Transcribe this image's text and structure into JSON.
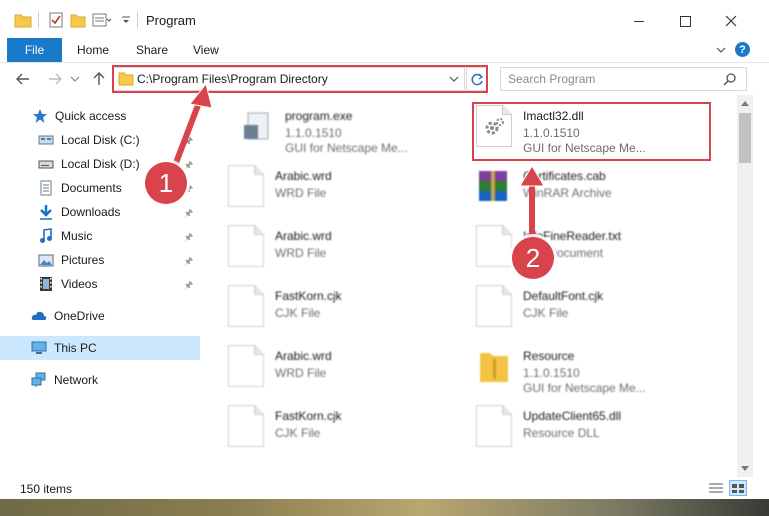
{
  "window": {
    "title": "Program",
    "controls": {
      "minimize": "—",
      "maximize": "☐",
      "close": "✕"
    }
  },
  "ribbon": {
    "tabs": [
      "File",
      "Home",
      "Share",
      "View"
    ],
    "expand_icon": "chevron-down-icon",
    "help": "?"
  },
  "address": {
    "path": "C:\\Program Files\\Program Directory",
    "search_placeholder": "Search Program"
  },
  "sidebar": {
    "items": [
      {
        "label": "Quick access",
        "icon": "star-icon"
      },
      {
        "label": "Local Disk (C:)",
        "icon": "drive-icon"
      },
      {
        "label": "Local Disk (D:)",
        "icon": "drive-icon"
      },
      {
        "label": "Documents",
        "icon": "documents-icon"
      },
      {
        "label": "Downloads",
        "icon": "download-icon"
      },
      {
        "label": "Music",
        "icon": "music-icon"
      },
      {
        "label": "Pictures",
        "icon": "pictures-icon"
      },
      {
        "label": "Videos",
        "icon": "videos-icon"
      },
      {
        "label": "OneDrive",
        "icon": "cloud-icon"
      },
      {
        "label": "This PC",
        "icon": "computer-icon"
      },
      {
        "label": "Network",
        "icon": "network-icon"
      }
    ]
  },
  "files": {
    "left": [
      {
        "name": "program.exe",
        "sub": "1.1.0.1510",
        "sub2": "GUI for Netscape Me..."
      },
      {
        "name": "Arabic.wrd",
        "sub": "WRD File"
      },
      {
        "name": "Arabic.wrd",
        "sub": "WRD File"
      },
      {
        "name": "FastKorn.cjk",
        "sub": "CJK File"
      },
      {
        "name": "Arabic.wrd",
        "sub": "WRD File"
      },
      {
        "name": "FastKorn.cjk",
        "sub": "CJK File"
      }
    ],
    "right": [
      {
        "name": "Imactl32.dll",
        "sub": "1.1.0.1510",
        "sub2": "GUI for Netscape Me..."
      },
      {
        "name": "Certificates.cab",
        "sub": "WinRAR Archive"
      },
      {
        "name": "InfoFineReader.txt",
        "sub": "Text Document"
      },
      {
        "name": "DefaultFont.cjk",
        "sub": "CJK File"
      },
      {
        "name": "Resource",
        "sub": "1.1.0.1510",
        "sub2": "GUI for Netscape Me..."
      },
      {
        "name": "UpdateClient65.dll",
        "sub": "Resource DLL"
      }
    ]
  },
  "status": {
    "count": "150 items"
  },
  "annotations": {
    "step1": "1",
    "step2": "2",
    "color": "#d9434b"
  },
  "colors": {
    "accent": "#1979ca",
    "selected": "#cce8ff",
    "annotation": "#d9434b"
  }
}
